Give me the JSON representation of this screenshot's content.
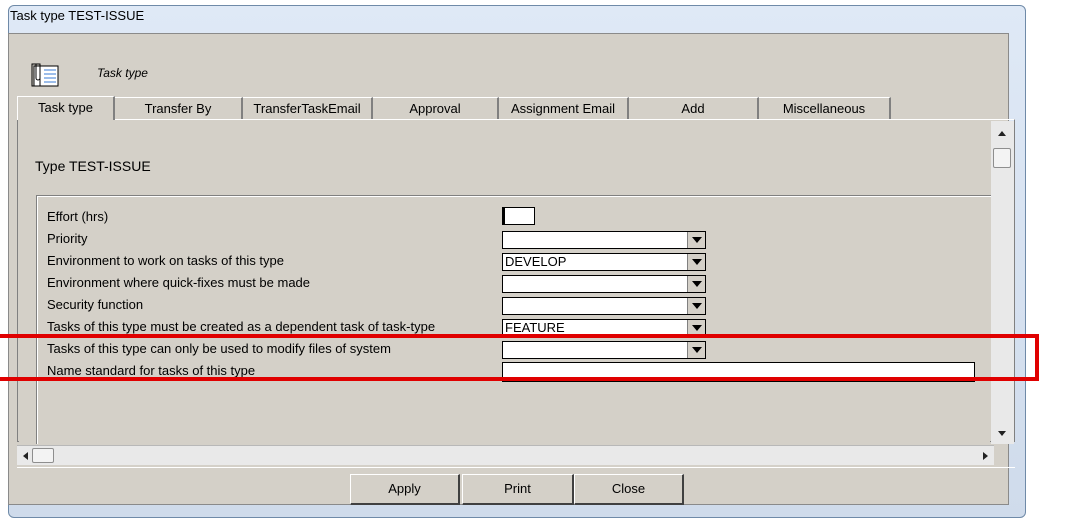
{
  "window": {
    "title": "Task type TEST-ISSUE"
  },
  "header": {
    "label": "Task type",
    "icon": "task-icon"
  },
  "tabs": [
    {
      "label": "Task type",
      "active": true
    },
    {
      "label": "Transfer By"
    },
    {
      "label": "TransferTaskEmail"
    },
    {
      "label": "Approval"
    },
    {
      "label": "Assignment Email"
    },
    {
      "label": "Add"
    },
    {
      "label": "Miscellaneous"
    }
  ],
  "form": {
    "type_label": "Type  TEST-ISSUE",
    "rows": [
      {
        "label": "Effort (hrs)",
        "value": ""
      },
      {
        "label": "Priority",
        "value": ""
      },
      {
        "label": "Environment to work on tasks of this type",
        "value": "DEVELOP"
      },
      {
        "label": "Environment where quick-fixes must be made",
        "value": ""
      },
      {
        "label": "Security function",
        "value": ""
      },
      {
        "label": "Tasks of this type must be created as a dependent task of task-type",
        "value": "FEATURE"
      },
      {
        "label": "Tasks of this type can only be used to modify files of system",
        "value": ""
      },
      {
        "label": "Name standard for tasks of this type",
        "value": ""
      }
    ]
  },
  "buttons": {
    "apply": "Apply",
    "print": "Print",
    "close": "Close"
  },
  "colors": {
    "highlight": "#e00000",
    "dialog_bg": "#d4d0c8"
  }
}
